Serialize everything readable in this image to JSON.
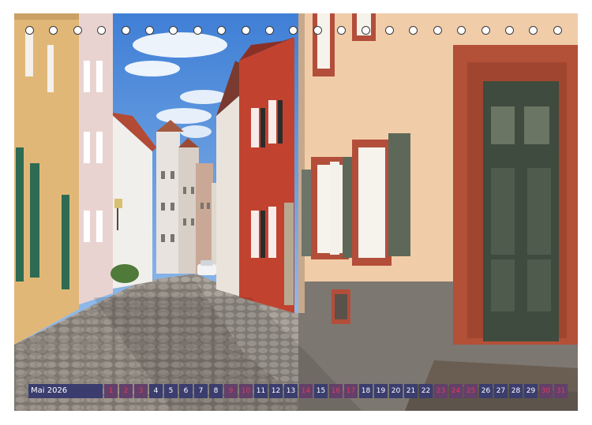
{
  "calendar": {
    "month": "Mai 2026",
    "days": [
      {
        "d": "1",
        "w": true
      },
      {
        "d": "2",
        "w": true
      },
      {
        "d": "3",
        "w": true
      },
      {
        "d": "4",
        "w": false
      },
      {
        "d": "5",
        "w": false
      },
      {
        "d": "6",
        "w": false
      },
      {
        "d": "7",
        "w": false
      },
      {
        "d": "8",
        "w": false
      },
      {
        "d": "9",
        "w": true
      },
      {
        "d": "10",
        "w": true
      },
      {
        "d": "11",
        "w": false
      },
      {
        "d": "12",
        "w": false
      },
      {
        "d": "13",
        "w": false
      },
      {
        "d": "14",
        "w": true
      },
      {
        "d": "15",
        "w": false
      },
      {
        "d": "16",
        "w": true
      },
      {
        "d": "17",
        "w": true
      },
      {
        "d": "18",
        "w": false
      },
      {
        "d": "19",
        "w": false
      },
      {
        "d": "20",
        "w": false
      },
      {
        "d": "21",
        "w": false
      },
      {
        "d": "22",
        "w": false
      },
      {
        "d": "23",
        "w": true
      },
      {
        "d": "24",
        "w": true
      },
      {
        "d": "25",
        "w": true
      },
      {
        "d": "26",
        "w": false
      },
      {
        "d": "27",
        "w": false
      },
      {
        "d": "28",
        "w": false
      },
      {
        "d": "29",
        "w": false
      },
      {
        "d": "30",
        "w": true
      },
      {
        "d": "31",
        "w": true
      }
    ]
  },
  "colors": {
    "calendar_bar": "#3a3d6e",
    "weekend_text": "#e23a5a",
    "binding_ring": "#3a3a3a"
  }
}
